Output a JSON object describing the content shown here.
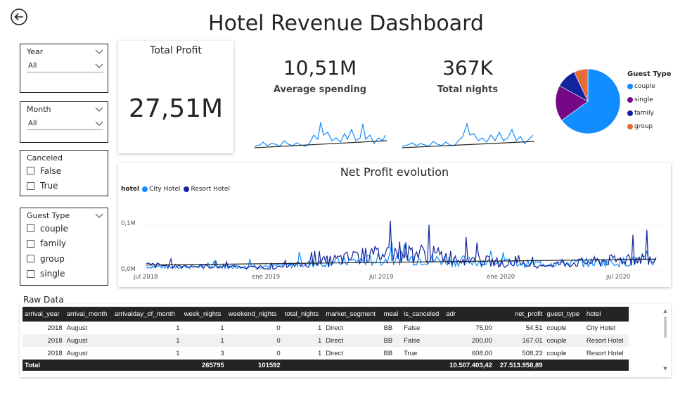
{
  "page": {
    "title": "Hotel Revenue Dashboard"
  },
  "filters": {
    "year": {
      "label": "Year",
      "value": "All"
    },
    "month": {
      "label": "Month",
      "value": "All"
    },
    "canceled": {
      "label": "Canceled",
      "options": [
        "False",
        "True"
      ]
    },
    "guest_type": {
      "label": "Guest Type",
      "options": [
        "couple",
        "family",
        "group",
        "single"
      ]
    }
  },
  "kpis": {
    "total_profit": {
      "label": "Total Profit",
      "value": "27,51M"
    },
    "average_spending": {
      "label": "Average spending",
      "value": "10,51M"
    },
    "total_nights": {
      "label": "Total nights",
      "value": "367K"
    }
  },
  "pie": {
    "title": "Guest Type",
    "items": [
      {
        "name": "couple",
        "color": "#118DFF",
        "share": 0.65
      },
      {
        "name": "single",
        "color": "#750985",
        "share": 0.18
      },
      {
        "name": "family",
        "color": "#12239E",
        "share": 0.1
      },
      {
        "name": "group",
        "color": "#E66C37",
        "share": 0.07
      }
    ]
  },
  "net_profit_chart": {
    "title": "Net Profit evolution",
    "legend_title": "hotel",
    "series": [
      {
        "name": "City Hotel",
        "color": "#118DFF"
      },
      {
        "name": "Resort Hotel",
        "color": "#12239E"
      }
    ],
    "y_ticks": [
      "0,1M",
      "0,0M"
    ],
    "x_ticks": [
      "jul 2018",
      "ene 2019",
      "jul 2019",
      "ene 2020",
      "jul 2020"
    ]
  },
  "chart_data": [
    {
      "type": "line",
      "title": "Net Profit evolution",
      "x": [
        "jul 2018",
        "ene 2019",
        "jul 2019",
        "ene 2020",
        "jul 2020"
      ],
      "ylim": [
        0,
        0.14
      ],
      "series": [
        {
          "name": "City Hotel",
          "values": [
            0.008,
            0.01,
            0.028,
            0.015,
            0.022
          ]
        },
        {
          "name": "Resort Hotel",
          "values": [
            0.012,
            0.005,
            0.045,
            0.01,
            0.03
          ]
        }
      ]
    },
    {
      "type": "pie",
      "title": "Guest Type",
      "categories": [
        "couple",
        "single",
        "family",
        "group"
      ],
      "values": [
        0.65,
        0.18,
        0.1,
        0.07
      ]
    }
  ],
  "raw_data": {
    "title": "Raw Data",
    "columns": [
      "arrival_year",
      "arrival_month",
      "arrivalday_of_month",
      "week_nights",
      "weekend_nights",
      "total_nights",
      "market_segment",
      "meal",
      "is_canceled",
      "adr",
      "net_profit",
      "guest_type",
      "hotel"
    ],
    "rows": [
      [
        "2018",
        "August",
        "1",
        "1",
        "0",
        "1",
        "Direct",
        "BB",
        "False",
        "75,00",
        "54,51",
        "couple",
        "City Hotel"
      ],
      [
        "2018",
        "August",
        "1",
        "1",
        "0",
        "1",
        "Direct",
        "BB",
        "False",
        "200,00",
        "167,01",
        "couple",
        "Resort Hotel"
      ],
      [
        "2018",
        "August",
        "1",
        "3",
        "0",
        "1",
        "Direct",
        "BB",
        "True",
        "608,00",
        "508,23",
        "couple",
        "Resort Hotel"
      ]
    ],
    "total": {
      "label": "Total",
      "week_nights": "265795",
      "weekend_nights": "101592",
      "adr": "10.507.403,42",
      "net_profit": "27.513.958,89"
    }
  }
}
